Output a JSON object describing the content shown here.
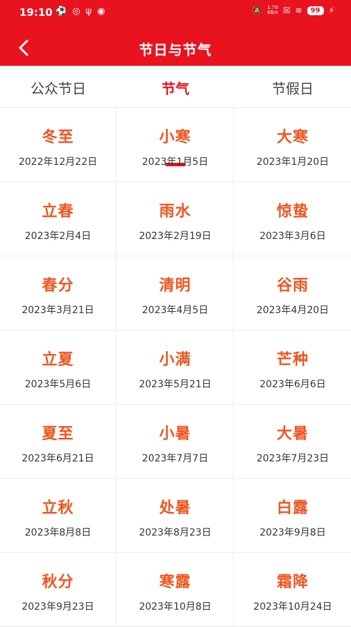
{
  "status_bar": {
    "time": "19:10",
    "net_speed_value": "1.70",
    "net_speed_unit": "KB/s",
    "battery": "99"
  },
  "header": {
    "title": "节日与节气"
  },
  "tabs": [
    {
      "label": "公众节日",
      "active": false
    },
    {
      "label": "节气",
      "active": true
    },
    {
      "label": "节假日",
      "active": false
    }
  ],
  "colors": {
    "brand_red": "#e8131f",
    "solar_term_orange": "#f0541e"
  },
  "solar_terms": [
    {
      "name": "冬至",
      "date": "2022年12月22日"
    },
    {
      "name": "小寒",
      "date": "2023年1月5日"
    },
    {
      "name": "大寒",
      "date": "2023年1月20日"
    },
    {
      "name": "立春",
      "date": "2023年2月4日"
    },
    {
      "name": "雨水",
      "date": "2023年2月19日"
    },
    {
      "name": "惊蛰",
      "date": "2023年3月6日"
    },
    {
      "name": "春分",
      "date": "2023年3月21日"
    },
    {
      "name": "清明",
      "date": "2023年4月5日"
    },
    {
      "name": "谷雨",
      "date": "2023年4月20日"
    },
    {
      "name": "立夏",
      "date": "2023年5月6日"
    },
    {
      "name": "小满",
      "date": "2023年5月21日"
    },
    {
      "name": "芒种",
      "date": "2023年6月6日"
    },
    {
      "name": "夏至",
      "date": "2023年6月21日"
    },
    {
      "name": "小暑",
      "date": "2023年7月7日"
    },
    {
      "name": "大暑",
      "date": "2023年7月23日"
    },
    {
      "name": "立秋",
      "date": "2023年8月8日"
    },
    {
      "name": "处暑",
      "date": "2023年8月23日"
    },
    {
      "name": "白露",
      "date": "2023年9月8日"
    },
    {
      "name": "秋分",
      "date": "2023年9月23日"
    },
    {
      "name": "寒露",
      "date": "2023年10月8日"
    },
    {
      "name": "霜降",
      "date": "2023年10月24日"
    }
  ]
}
